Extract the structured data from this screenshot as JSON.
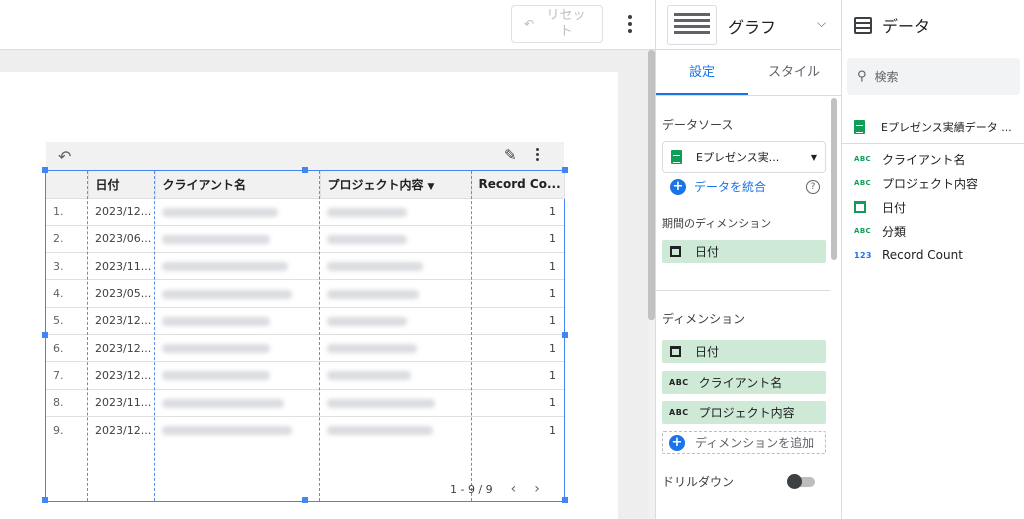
{
  "toolbar": {
    "reset_label": "リセット",
    "reset_icon": "undo-icon",
    "more_icon": "more-vert-icon"
  },
  "table": {
    "columns": [
      "",
      "日付",
      "クライアント名",
      "プロジェクト内容",
      "Record Co..."
    ],
    "sorted_column": "プロジェクト内容",
    "rows": [
      {
        "n": "1.",
        "date": "2023/12...",
        "count": "1"
      },
      {
        "n": "2.",
        "date": "2023/06...",
        "count": "1"
      },
      {
        "n": "3.",
        "date": "2023/11...",
        "count": "1"
      },
      {
        "n": "4.",
        "date": "2023/05...",
        "count": "1"
      },
      {
        "n": "5.",
        "date": "2023/12...",
        "count": "1"
      },
      {
        "n": "6.",
        "date": "2023/12...",
        "count": "1"
      },
      {
        "n": "7.",
        "date": "2023/12...",
        "count": "1"
      },
      {
        "n": "8.",
        "date": "2023/11...",
        "count": "1"
      },
      {
        "n": "9.",
        "date": "2023/12...",
        "count": "1"
      }
    ],
    "pagination": "1 - 9 / 9"
  },
  "props": {
    "chart_type": "グラフ",
    "tabs": [
      {
        "label": "設定",
        "active": true
      },
      {
        "label": "スタイル",
        "active": false
      }
    ],
    "datasource_label": "データソース",
    "datasource_name": "Eプレゼンス実...",
    "merge_label": "データを統合",
    "period_dimension_label": "期間のディメンション",
    "period_dimension": "日付",
    "dimension_label": "ディメンション",
    "dimensions": [
      {
        "name": "日付",
        "type": "date"
      },
      {
        "name": "クライアント名",
        "type": "text"
      },
      {
        "name": "プロジェクト内容",
        "type": "text"
      }
    ],
    "abc_tag": "ABC",
    "add_dimension_label": "ディメンションを追加",
    "drilldown_label": "ドリルダウン"
  },
  "data_panel": {
    "title": "データ",
    "search_placeholder": "検索",
    "datasource": "Eプレゼンス実績データ ...",
    "fields": [
      {
        "name": "クライアント名",
        "type": "ABC"
      },
      {
        "name": "プロジェクト内容",
        "type": "ABC"
      },
      {
        "name": "日付",
        "type": "date"
      },
      {
        "name": "分類",
        "type": "ABC"
      },
      {
        "name": "Record Count",
        "type": "123"
      }
    ]
  },
  "colors": {
    "accent": "#1a73e8",
    "selection": "#4285f4",
    "chip": "#ceead6",
    "sheet_green": "#0f9d58"
  }
}
